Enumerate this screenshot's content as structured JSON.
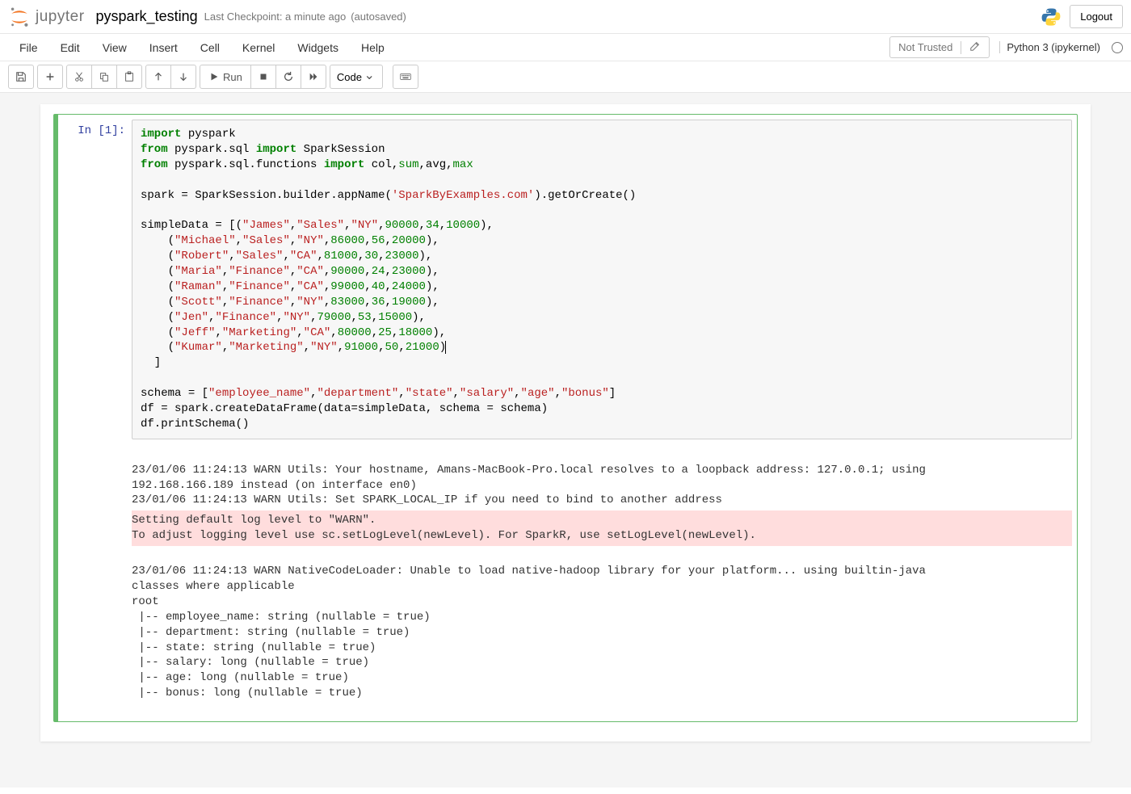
{
  "header": {
    "logo_text": "jupyter",
    "notebook_name": "pyspark_testing",
    "checkpoint_text": "Last Checkpoint: a minute ago",
    "autosaved_text": "(autosaved)",
    "logout_label": "Logout"
  },
  "menubar": {
    "items": [
      "File",
      "Edit",
      "View",
      "Insert",
      "Cell",
      "Kernel",
      "Widgets",
      "Help"
    ],
    "trust_label": "Not Trusted",
    "kernel_name": "Python 3 (ipykernel)"
  },
  "toolbar": {
    "run_label": "Run",
    "cell_type": "Code"
  },
  "cell": {
    "prompt": "In [1]:",
    "code_tokens": [
      [
        [
          "kw",
          "import"
        ],
        [
          "sp",
          " "
        ],
        [
          "nm",
          "pyspark"
        ]
      ],
      [
        [
          "kw",
          "from"
        ],
        [
          "sp",
          " "
        ],
        [
          "nm",
          "pyspark.sql"
        ],
        [
          "sp",
          " "
        ],
        [
          "kw",
          "import"
        ],
        [
          "sp",
          " "
        ],
        [
          "nm",
          "SparkSession"
        ]
      ],
      [
        [
          "kw",
          "from"
        ],
        [
          "sp",
          " "
        ],
        [
          "nm",
          "pyspark.sql.functions"
        ],
        [
          "sp",
          " "
        ],
        [
          "kw",
          "import"
        ],
        [
          "sp",
          " "
        ],
        [
          "nm",
          "col,"
        ],
        [
          "bi",
          "sum"
        ],
        [
          "nm",
          ",avg,"
        ],
        [
          "bi",
          "max"
        ]
      ],
      [],
      [
        [
          "nm",
          "spark "
        ],
        [
          "op",
          "="
        ],
        [
          "nm",
          " SparkSession.builder.appName("
        ],
        [
          "str",
          "'SparkByExamples.com'"
        ],
        [
          "nm",
          ").getOrCreate()"
        ]
      ],
      [],
      [
        [
          "nm",
          "simpleData "
        ],
        [
          "op",
          "="
        ],
        [
          "nm",
          " [("
        ],
        [
          "str",
          "\"James\""
        ],
        [
          "nm",
          ","
        ],
        [
          "str",
          "\"Sales\""
        ],
        [
          "nm",
          ","
        ],
        [
          "str",
          "\"NY\""
        ],
        [
          "nm",
          ","
        ],
        [
          "num",
          "90000"
        ],
        [
          "nm",
          ","
        ],
        [
          "num",
          "34"
        ],
        [
          "nm",
          ","
        ],
        [
          "num",
          "10000"
        ],
        [
          "nm",
          "),"
        ]
      ],
      [
        [
          "nm",
          "    ("
        ],
        [
          "str",
          "\"Michael\""
        ],
        [
          "nm",
          ","
        ],
        [
          "str",
          "\"Sales\""
        ],
        [
          "nm",
          ","
        ],
        [
          "str",
          "\"NY\""
        ],
        [
          "nm",
          ","
        ],
        [
          "num",
          "86000"
        ],
        [
          "nm",
          ","
        ],
        [
          "num",
          "56"
        ],
        [
          "nm",
          ","
        ],
        [
          "num",
          "20000"
        ],
        [
          "nm",
          "),"
        ]
      ],
      [
        [
          "nm",
          "    ("
        ],
        [
          "str",
          "\"Robert\""
        ],
        [
          "nm",
          ","
        ],
        [
          "str",
          "\"Sales\""
        ],
        [
          "nm",
          ","
        ],
        [
          "str",
          "\"CA\""
        ],
        [
          "nm",
          ","
        ],
        [
          "num",
          "81000"
        ],
        [
          "nm",
          ","
        ],
        [
          "num",
          "30"
        ],
        [
          "nm",
          ","
        ],
        [
          "num",
          "23000"
        ],
        [
          "nm",
          "),"
        ]
      ],
      [
        [
          "nm",
          "    ("
        ],
        [
          "str",
          "\"Maria\""
        ],
        [
          "nm",
          ","
        ],
        [
          "str",
          "\"Finance\""
        ],
        [
          "nm",
          ","
        ],
        [
          "str",
          "\"CA\""
        ],
        [
          "nm",
          ","
        ],
        [
          "num",
          "90000"
        ],
        [
          "nm",
          ","
        ],
        [
          "num",
          "24"
        ],
        [
          "nm",
          ","
        ],
        [
          "num",
          "23000"
        ],
        [
          "nm",
          "),"
        ]
      ],
      [
        [
          "nm",
          "    ("
        ],
        [
          "str",
          "\"Raman\""
        ],
        [
          "nm",
          ","
        ],
        [
          "str",
          "\"Finance\""
        ],
        [
          "nm",
          ","
        ],
        [
          "str",
          "\"CA\""
        ],
        [
          "nm",
          ","
        ],
        [
          "num",
          "99000"
        ],
        [
          "nm",
          ","
        ],
        [
          "num",
          "40"
        ],
        [
          "nm",
          ","
        ],
        [
          "num",
          "24000"
        ],
        [
          "nm",
          "),"
        ]
      ],
      [
        [
          "nm",
          "    ("
        ],
        [
          "str",
          "\"Scott\""
        ],
        [
          "nm",
          ","
        ],
        [
          "str",
          "\"Finance\""
        ],
        [
          "nm",
          ","
        ],
        [
          "str",
          "\"NY\""
        ],
        [
          "nm",
          ","
        ],
        [
          "num",
          "83000"
        ],
        [
          "nm",
          ","
        ],
        [
          "num",
          "36"
        ],
        [
          "nm",
          ","
        ],
        [
          "num",
          "19000"
        ],
        [
          "nm",
          "),"
        ]
      ],
      [
        [
          "nm",
          "    ("
        ],
        [
          "str",
          "\"Jen\""
        ],
        [
          "nm",
          ","
        ],
        [
          "str",
          "\"Finance\""
        ],
        [
          "nm",
          ","
        ],
        [
          "str",
          "\"NY\""
        ],
        [
          "nm",
          ","
        ],
        [
          "num",
          "79000"
        ],
        [
          "nm",
          ","
        ],
        [
          "num",
          "53"
        ],
        [
          "nm",
          ","
        ],
        [
          "num",
          "15000"
        ],
        [
          "nm",
          "),"
        ]
      ],
      [
        [
          "nm",
          "    ("
        ],
        [
          "str",
          "\"Jeff\""
        ],
        [
          "nm",
          ","
        ],
        [
          "str",
          "\"Marketing\""
        ],
        [
          "nm",
          ","
        ],
        [
          "str",
          "\"CA\""
        ],
        [
          "nm",
          ","
        ],
        [
          "num",
          "80000"
        ],
        [
          "nm",
          ","
        ],
        [
          "num",
          "25"
        ],
        [
          "nm",
          ","
        ],
        [
          "num",
          "18000"
        ],
        [
          "nm",
          "),"
        ]
      ],
      [
        [
          "nm",
          "    ("
        ],
        [
          "str",
          "\"Kumar\""
        ],
        [
          "nm",
          ","
        ],
        [
          "str",
          "\"Marketing\""
        ],
        [
          "nm",
          ","
        ],
        [
          "str",
          "\"NY\""
        ],
        [
          "nm",
          ","
        ],
        [
          "num",
          "91000"
        ],
        [
          "nm",
          ","
        ],
        [
          "num",
          "50"
        ],
        [
          "nm",
          ","
        ],
        [
          "num",
          "21000"
        ],
        [
          "nm",
          ")"
        ],
        [
          "cursor",
          ""
        ]
      ],
      [
        [
          "nm",
          "  ]"
        ]
      ],
      [],
      [
        [
          "nm",
          "schema "
        ],
        [
          "op",
          "="
        ],
        [
          "nm",
          " ["
        ],
        [
          "str",
          "\"employee_name\""
        ],
        [
          "nm",
          ","
        ],
        [
          "str",
          "\"department\""
        ],
        [
          "nm",
          ","
        ],
        [
          "str",
          "\"state\""
        ],
        [
          "nm",
          ","
        ],
        [
          "str",
          "\"salary\""
        ],
        [
          "nm",
          ","
        ],
        [
          "str",
          "\"age\""
        ],
        [
          "nm",
          ","
        ],
        [
          "str",
          "\"bonus\""
        ],
        [
          "nm",
          "]"
        ]
      ],
      [
        [
          "nm",
          "df "
        ],
        [
          "op",
          "="
        ],
        [
          "nm",
          " spark.createDataFrame(data"
        ],
        [
          "op",
          "="
        ],
        [
          "nm",
          "simpleData, schema "
        ],
        [
          "op",
          "="
        ],
        [
          "nm",
          " schema)"
        ]
      ],
      [
        [
          "nm",
          "df.printSchema()"
        ]
      ]
    ],
    "output1": "23/01/06 11:24:13 WARN Utils: Your hostname, Amans-MacBook-Pro.local resolves to a loopback address: 127.0.0.1; using\n192.168.166.189 instead (on interface en0)\n23/01/06 11:24:13 WARN Utils: Set SPARK_LOCAL_IP if you need to bind to another address",
    "stderr": "Setting default log level to \"WARN\".\nTo adjust logging level use sc.setLogLevel(newLevel). For SparkR, use setLogLevel(newLevel).",
    "output2": "23/01/06 11:24:13 WARN NativeCodeLoader: Unable to load native-hadoop library for your platform... using builtin-java\nclasses where applicable\nroot\n |-- employee_name: string (nullable = true)\n |-- department: string (nullable = true)\n |-- state: string (nullable = true)\n |-- salary: long (nullable = true)\n |-- age: long (nullable = true)\n |-- bonus: long (nullable = true)"
  }
}
